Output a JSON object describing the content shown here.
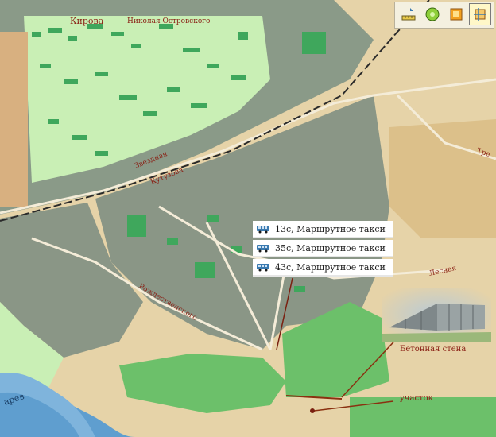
{
  "map": {
    "streets": [
      {
        "id": "kirova",
        "label": "Кирова"
      },
      {
        "id": "ostrovskogo",
        "label": "Николая Островского"
      },
      {
        "id": "zvezdnaya",
        "label": "Звездная"
      },
      {
        "id": "kutuzova",
        "label": "Кутузова"
      },
      {
        "id": "rozhdestvenskogo",
        "label": "Рождественского"
      },
      {
        "id": "lesnaya",
        "label": "Лесная"
      },
      {
        "id": "tretya",
        "label": "Тре"
      },
      {
        "id": "river",
        "label": "арев"
      }
    ],
    "routes": [
      {
        "label": "13с, Маршрутное такси",
        "icon": "bus-icon"
      },
      {
        "label": "35с, Маршрутное такси",
        "icon": "bus-icon"
      },
      {
        "label": "43с, Маршрутное такси",
        "icon": "bus-icon"
      }
    ],
    "annotations": {
      "wall": "Бетонная стена",
      "plot": "участок"
    },
    "toolbar": [
      {
        "id": "ruler",
        "icon": "ruler-icon",
        "active": false
      },
      {
        "id": "globe",
        "icon": "globe-icon",
        "active": false
      },
      {
        "id": "layers",
        "icon": "layers-icon",
        "active": false
      },
      {
        "id": "pan",
        "icon": "pan-icon",
        "active": true
      }
    ],
    "colors": {
      "background": "#e6d3a8",
      "urban_grey": "#8a9686",
      "green_zone": "#7fc98a",
      "light_green": "#c7efb0",
      "forest": "#6cc06a",
      "river": "#5f9ecf",
      "railway": "#2a2a2a",
      "street_label": "#8a1f14"
    }
  }
}
